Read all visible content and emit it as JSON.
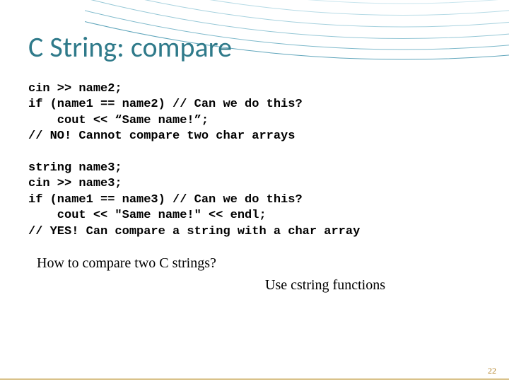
{
  "title": "C String: compare",
  "code_block_1": "cin >> name2;\nif (name1 == name2) // Can we do this?\n    cout << “Same name!”;\n// NO! Cannot compare two char arrays",
  "code_block_2": "string name3;\ncin >> name3;\nif (name1 == name3) // Can we do this?\n    cout << \"Same name!\" << endl;\n// YES! Can compare a string with a char array",
  "question": "How to compare two C strings?",
  "answer": "Use cstring functions",
  "page_number": "22"
}
